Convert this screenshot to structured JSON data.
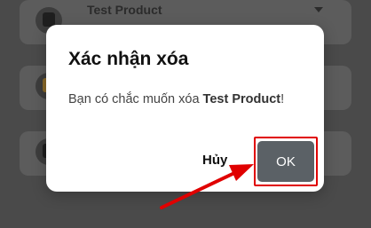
{
  "background_list": {
    "items": [
      {
        "title": "Test Product",
        "thumb": "product-image"
      },
      {
        "title": "",
        "thumb": "product-image"
      },
      {
        "title": "",
        "thumb": "product-image"
      }
    ]
  },
  "dialog": {
    "title": "Xác nhận xóa",
    "message_prefix": "Bạn có chắc muốn xóa ",
    "message_product": "Test Product",
    "message_suffix": "!",
    "cancel_label": "Hủy",
    "ok_label": "OK"
  },
  "annotation": {
    "highlight_color": "#e00000",
    "arrow_color": "#e00000"
  },
  "colors": {
    "overlay_bg": "#4a4a4a",
    "dialog_bg": "#ffffff",
    "ok_button_bg": "#5b6166"
  }
}
